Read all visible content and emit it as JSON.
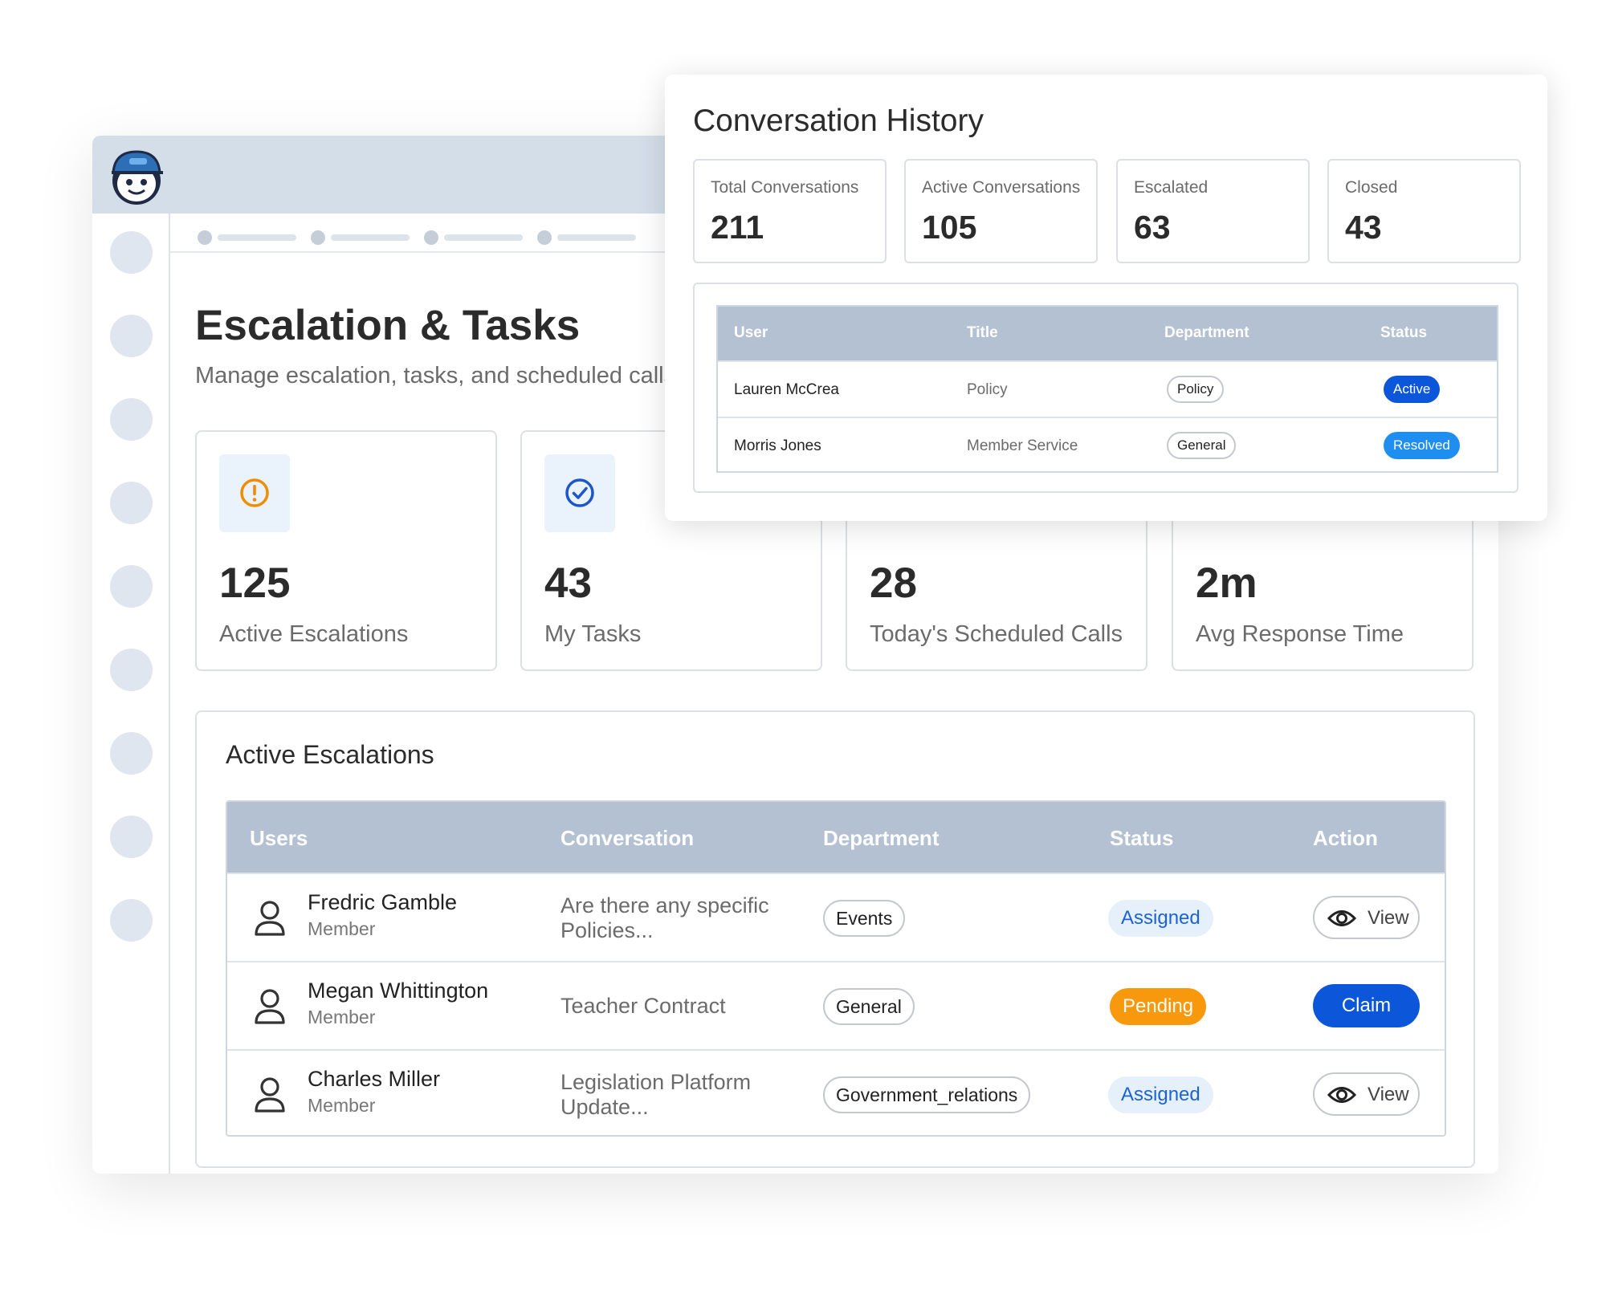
{
  "colors": {
    "accent": "#0b56d9",
    "pending": "#f7980d",
    "resolved": "#1e8ef0",
    "header_bg": "#b3c1d3",
    "topbar_bg": "#d4dee9"
  },
  "page": {
    "title": "Escalation & Tasks",
    "subtitle": "Manage escalation, tasks, and scheduled calls"
  },
  "stats": [
    {
      "icon": "alert-circle-icon",
      "value": "125",
      "label": "Active Escalations"
    },
    {
      "icon": "check-circle-icon",
      "value": "43",
      "label": "My Tasks"
    },
    {
      "icon": "",
      "value": "28",
      "label": "Today's Scheduled Calls"
    },
    {
      "icon": "",
      "value": "2m",
      "label": "Avg Response Time"
    }
  ],
  "escalations": {
    "title": "Active Escalations",
    "columns": [
      "Users",
      "Conversation",
      "Department",
      "Status",
      "Action"
    ],
    "rows": [
      {
        "name": "Fredric Gamble",
        "role": "Member",
        "conversation": "Are there any specific Policies...",
        "department": "Events",
        "status": "Assigned",
        "action": "View"
      },
      {
        "name": "Megan Whittington",
        "role": "Member",
        "conversation": "Teacher Contract",
        "department": "General",
        "status": "Pending",
        "action": "Claim"
      },
      {
        "name": "Charles Miller",
        "role": "Member",
        "conversation": "Legislation Platform Update...",
        "department": "Government_relations",
        "status": "Assigned",
        "action": "View"
      }
    ]
  },
  "history": {
    "title": "Conversation History",
    "cards": [
      {
        "label": "Total Conversations",
        "value": "211"
      },
      {
        "label": "Active Conversations",
        "value": "105"
      },
      {
        "label": "Escalated",
        "value": "63"
      },
      {
        "label": "Closed",
        "value": "43"
      }
    ],
    "columns": [
      "User",
      "Title",
      "Department",
      "Status"
    ],
    "rows": [
      {
        "user": "Lauren McCrea",
        "title": "Policy",
        "department": "Policy",
        "status": "Active"
      },
      {
        "user": "Morris Jones",
        "title": "Member Service",
        "department": "General",
        "status": "Resolved"
      }
    ]
  }
}
